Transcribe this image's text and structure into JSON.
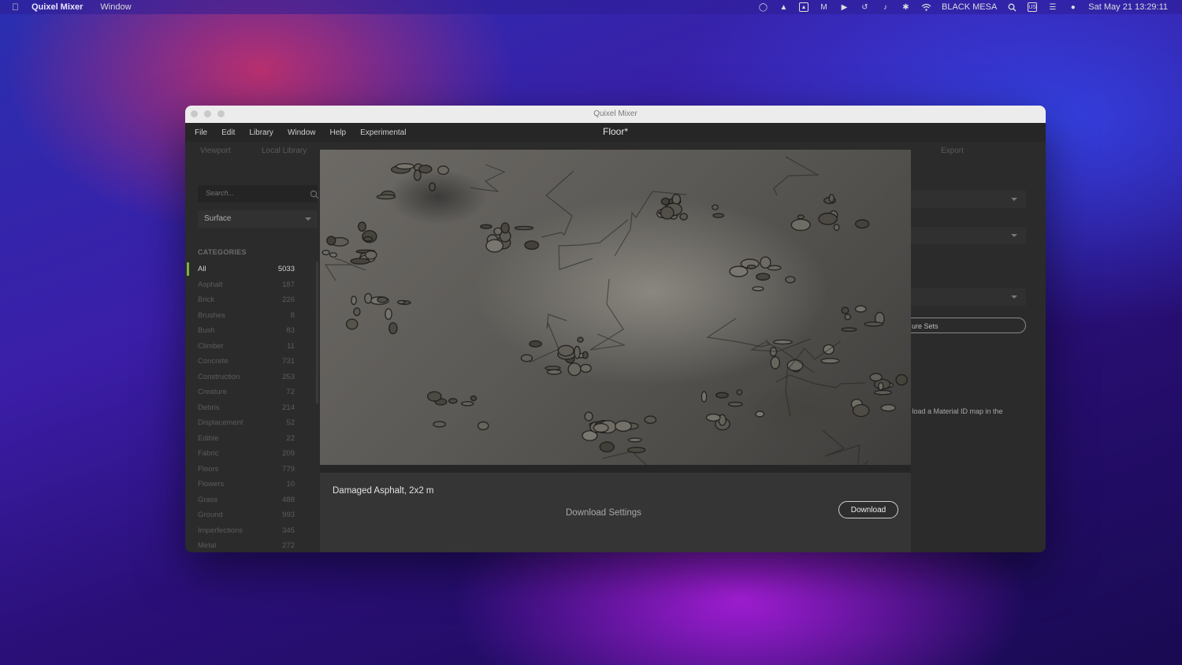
{
  "menubar": {
    "app_name": "Quixel Mixer",
    "menu_window": "Window",
    "computer_name": "BLACK MESA",
    "input_source": "US",
    "clock": "Sat May 21  13:29:11"
  },
  "window": {
    "title": "Quixel Mixer",
    "document_title": "Floor*",
    "menu": [
      "File",
      "Edit",
      "Library",
      "Window",
      "Help",
      "Experimental"
    ],
    "tabs": {
      "viewport": "Viewport",
      "local_library": "Local Library",
      "export": "Export"
    }
  },
  "sidebar": {
    "search_placeholder": "Search...",
    "surface_value": "Surface",
    "categories_heading": "CATEGORIES",
    "categories": [
      {
        "name": "All",
        "count": "5033"
      },
      {
        "name": "Asphalt",
        "count": "187"
      },
      {
        "name": "Brick",
        "count": "226"
      },
      {
        "name": "Brushes",
        "count": "8"
      },
      {
        "name": "Bush",
        "count": "83"
      },
      {
        "name": "Climber",
        "count": "11"
      },
      {
        "name": "Concrete",
        "count": "731"
      },
      {
        "name": "Construction",
        "count": "253"
      },
      {
        "name": "Creature",
        "count": "72"
      },
      {
        "name": "Debris",
        "count": "214"
      },
      {
        "name": "Displacement",
        "count": "52"
      },
      {
        "name": "Edible",
        "count": "22"
      },
      {
        "name": "Fabric",
        "count": "209"
      },
      {
        "name": "Floors",
        "count": "779"
      },
      {
        "name": "Flowers",
        "count": "10"
      },
      {
        "name": "Grass",
        "count": "488"
      },
      {
        "name": "Ground",
        "count": "993"
      },
      {
        "name": "Imperfections",
        "count": "345"
      },
      {
        "name": "Metal",
        "count": "272"
      }
    ]
  },
  "right_panel": {
    "button_text": "ure Sets",
    "info_text": "n load a Material ID map in the"
  },
  "dialog": {
    "asset_name": "Damaged Asphalt, 2x2 m",
    "download_settings": "Download Settings",
    "download_button": "Download"
  },
  "colors": {
    "accent_category": "#7cb342",
    "window_bg": "#2b2b2b",
    "dialog_bg": "#353535"
  }
}
